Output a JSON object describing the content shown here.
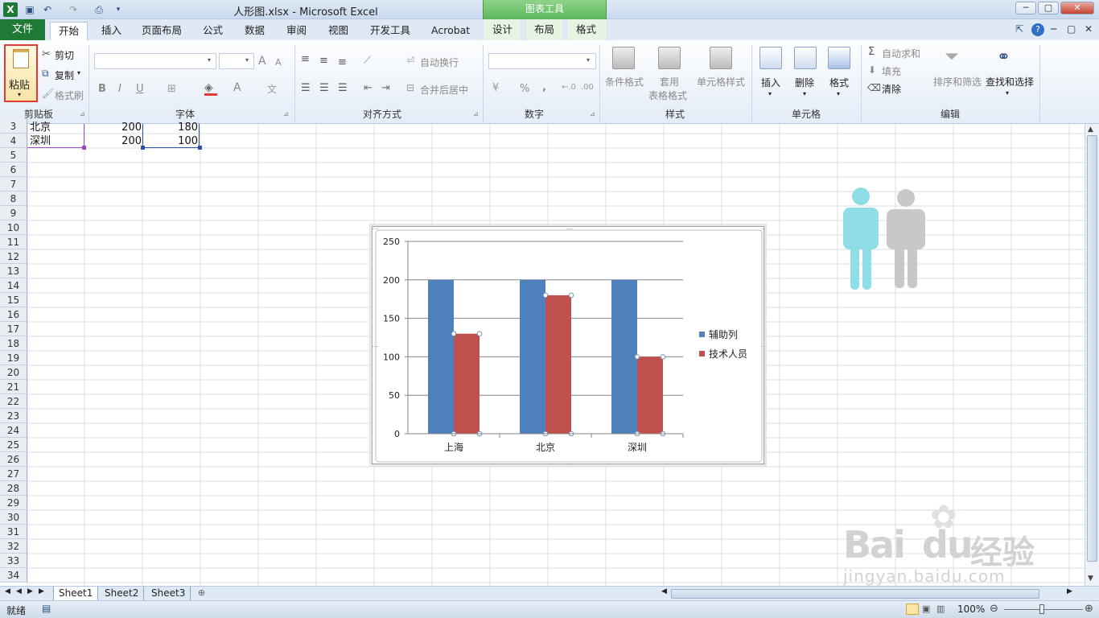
{
  "window": {
    "title": "人形图.xlsx - Microsoft Excel",
    "context_tab_group": "图表工具",
    "controls": [
      "─",
      "▢",
      "✕"
    ]
  },
  "tabs": {
    "file": "文件",
    "home": "开始",
    "insert": "插入",
    "page_layout": "页面布局",
    "formulas": "公式",
    "data": "数据",
    "review": "审阅",
    "view": "视图",
    "developer": "开发工具",
    "acrobat": "Acrobat",
    "design": "设计",
    "layout": "布局",
    "format": "格式"
  },
  "ribbon": {
    "clipboard": {
      "label": "剪贴板",
      "paste": "粘贴",
      "cut": "剪切",
      "copy": "复制",
      "format_painter": "格式刷"
    },
    "font": {
      "label": "字体",
      "bold": "B",
      "italic": "I",
      "underline": "U",
      "grow": "A",
      "shrink": "A"
    },
    "alignment": {
      "label": "对齐方式",
      "wrap_text": "自动换行",
      "merge_center": "合并后居中"
    },
    "number": {
      "label": "数字",
      "percent": "%",
      "comma": ","
    },
    "styles": {
      "label": "样式",
      "conditional": "条件格式",
      "table_format_1": "套用",
      "table_format_2": "表格格式",
      "cell_styles": "单元格样式"
    },
    "cells": {
      "label": "单元格",
      "insert": "插入",
      "delete": "删除",
      "format": "格式"
    },
    "editing": {
      "label": "编辑",
      "autosum": "自动求和",
      "fill": "填充",
      "clear": "清除",
      "sort_filter": "排序和筛选",
      "find_select": "查找和选择"
    }
  },
  "rows": [
    "3",
    "4",
    "5",
    "6",
    "7",
    "8",
    "9",
    "10",
    "11",
    "12",
    "13",
    "14",
    "15",
    "16",
    "17",
    "18",
    "19",
    "20",
    "21",
    "22",
    "23",
    "24",
    "25",
    "26",
    "27",
    "28",
    "29",
    "30",
    "31",
    "32",
    "33",
    "34"
  ],
  "cells": {
    "r3": {
      "a": "北京",
      "b": "200",
      "c": "180"
    },
    "r4": {
      "a": "深圳",
      "b": "200",
      "c": "100"
    }
  },
  "chart_data": {
    "type": "bar",
    "categories": [
      "上海",
      "北京",
      "深圳"
    ],
    "series": [
      {
        "name": "辅助列",
        "values": [
          200,
          200,
          200
        ],
        "color": "#4f81bd"
      },
      {
        "name": "技术人员",
        "values": [
          130,
          180,
          100
        ],
        "color": "#c0504d"
      }
    ],
    "ylim": [
      0,
      250
    ],
    "yticks": [
      "0",
      "50",
      "100",
      "150",
      "200",
      "250"
    ],
    "grid": true,
    "legend": "right"
  },
  "decor": {
    "person_colors": [
      "#8fdde6",
      "#c8c8c8"
    ]
  },
  "sheet_tabs": [
    "Sheet1",
    "Sheet2",
    "Sheet3"
  ],
  "status": {
    "ready": "就绪",
    "zoom": "100%"
  },
  "watermark": {
    "brand": "Bai",
    "brand2": "du",
    "cn": "经验",
    "url": "jingyan.baidu.com"
  }
}
